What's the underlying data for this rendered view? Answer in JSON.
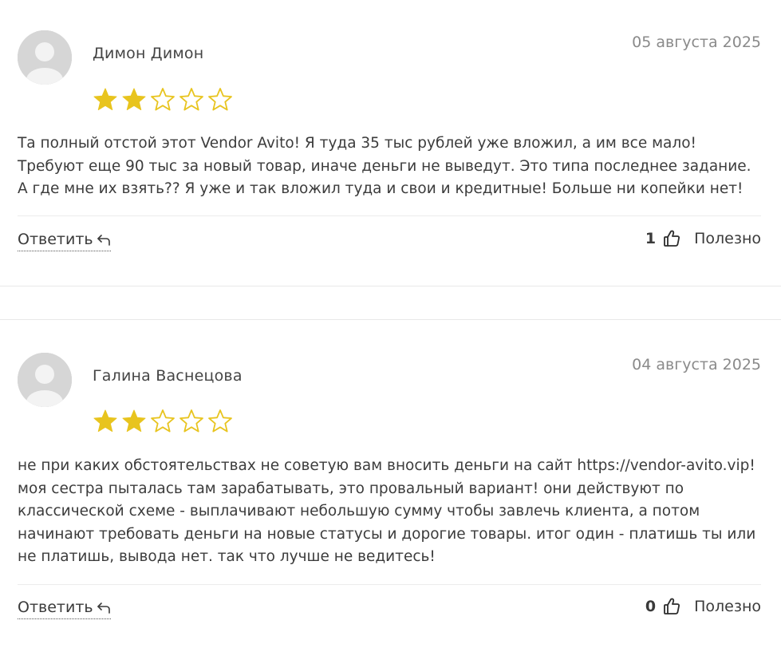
{
  "reviews": [
    {
      "author": "Димон Димон",
      "date": "05 августа 2025",
      "rating": 2,
      "rating_max": 5,
      "text": "Та полный отстой этот Vendor Avito! Я туда 35 тыс рублей уже вложил, а им все мало! Требуют еще 90 тыс за новый товар, иначе деньги не выведут. Это типа последнее задание. А где мне их взять?? Я уже и так вложил туда и свои и кредитные! Больше ни копейки нет!",
      "reply_label": "Ответить",
      "helpful_count": "1",
      "helpful_label": "Полезно"
    },
    {
      "author": "Галина Васнецова",
      "date": "04 августа 2025",
      "rating": 2,
      "rating_max": 5,
      "text": "не при каких обстоятельствах не советую вам вносить деньги на сайт https://vendor-avito.vip! моя сестра пыталась там зарабатывать, это провальный вариант! они действуют по классической схеме - выплачивают небольшую сумму чтобы завлечь клиента, а потом начинают требовать деньги на новые статусы и дорогие товары. итог один - платишь ты или не платишь, вывода нет. так что лучше не ведитесь!",
      "reply_label": "Ответить",
      "helpful_count": "0",
      "helpful_label": "Полезно"
    }
  ],
  "colors": {
    "star_filled": "#e8c41e",
    "star_empty_stroke": "#e8c41e",
    "date": "#8a8a8a",
    "text": "#3c3c3c"
  },
  "icons": {
    "avatar": "user-avatar-placeholder-icon",
    "reply": "reply-arrow-icon",
    "helpful": "thumbs-up-icon",
    "star": "star-icon"
  }
}
